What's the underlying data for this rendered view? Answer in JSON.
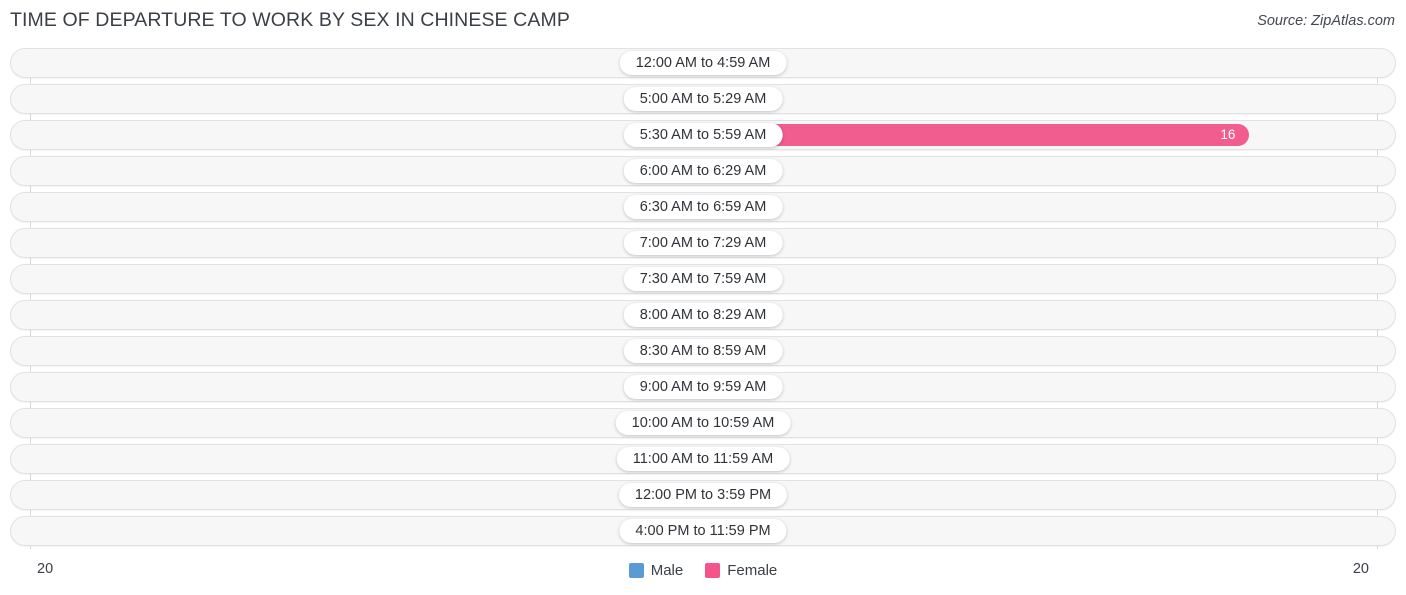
{
  "header": {
    "title": "TIME OF DEPARTURE TO WORK BY SEX IN CHINESE CAMP",
    "source": "Source: ZipAtlas.com"
  },
  "axis": {
    "left_tick": "20",
    "right_tick": "20"
  },
  "legend": {
    "items": [
      {
        "label": "Male",
        "color": "#5b9bd5"
      },
      {
        "label": "Female",
        "color": "#f4548b"
      }
    ]
  },
  "colors": {
    "male_bar": "#a9c8ea",
    "female_bar": "#f4a9c3",
    "female_bar_highlight": "#f05d8e",
    "male_legend": "#5b9bd5",
    "female_legend": "#f4548b"
  },
  "chart_data": {
    "type": "bar",
    "title": "TIME OF DEPARTURE TO WORK BY SEX IN CHINESE CAMP",
    "orientation": "horizontal-diverging",
    "xlabel": "",
    "ylabel": "",
    "xlim": [
      20,
      20
    ],
    "grid": true,
    "legend_position": "bottom-center",
    "categories": [
      "12:00 AM to 4:59 AM",
      "5:00 AM to 5:29 AM",
      "5:30 AM to 5:59 AM",
      "6:00 AM to 6:29 AM",
      "6:30 AM to 6:59 AM",
      "7:00 AM to 7:29 AM",
      "7:30 AM to 7:59 AM",
      "8:00 AM to 8:29 AM",
      "8:30 AM to 8:59 AM",
      "9:00 AM to 9:59 AM",
      "10:00 AM to 10:59 AM",
      "11:00 AM to 11:59 AM",
      "12:00 PM to 3:59 PM",
      "4:00 PM to 11:59 PM"
    ],
    "series": [
      {
        "name": "Male",
        "values": [
          0,
          0,
          0,
          0,
          0,
          0,
          0,
          0,
          0,
          0,
          0,
          0,
          0,
          0
        ],
        "labels": [
          "0",
          "0",
          "0",
          "0",
          "0",
          "0",
          "0",
          "0",
          "0",
          "0",
          "0",
          "0",
          "0",
          "0"
        ]
      },
      {
        "name": "Female",
        "values": [
          0,
          0,
          16,
          0,
          0,
          0,
          0,
          0,
          0,
          0,
          0,
          0,
          0,
          0
        ],
        "labels": [
          "0",
          "0",
          "16",
          "0",
          "0",
          "0",
          "0",
          "0",
          "0",
          "0",
          "0",
          "0",
          "0",
          "0"
        ]
      }
    ]
  }
}
